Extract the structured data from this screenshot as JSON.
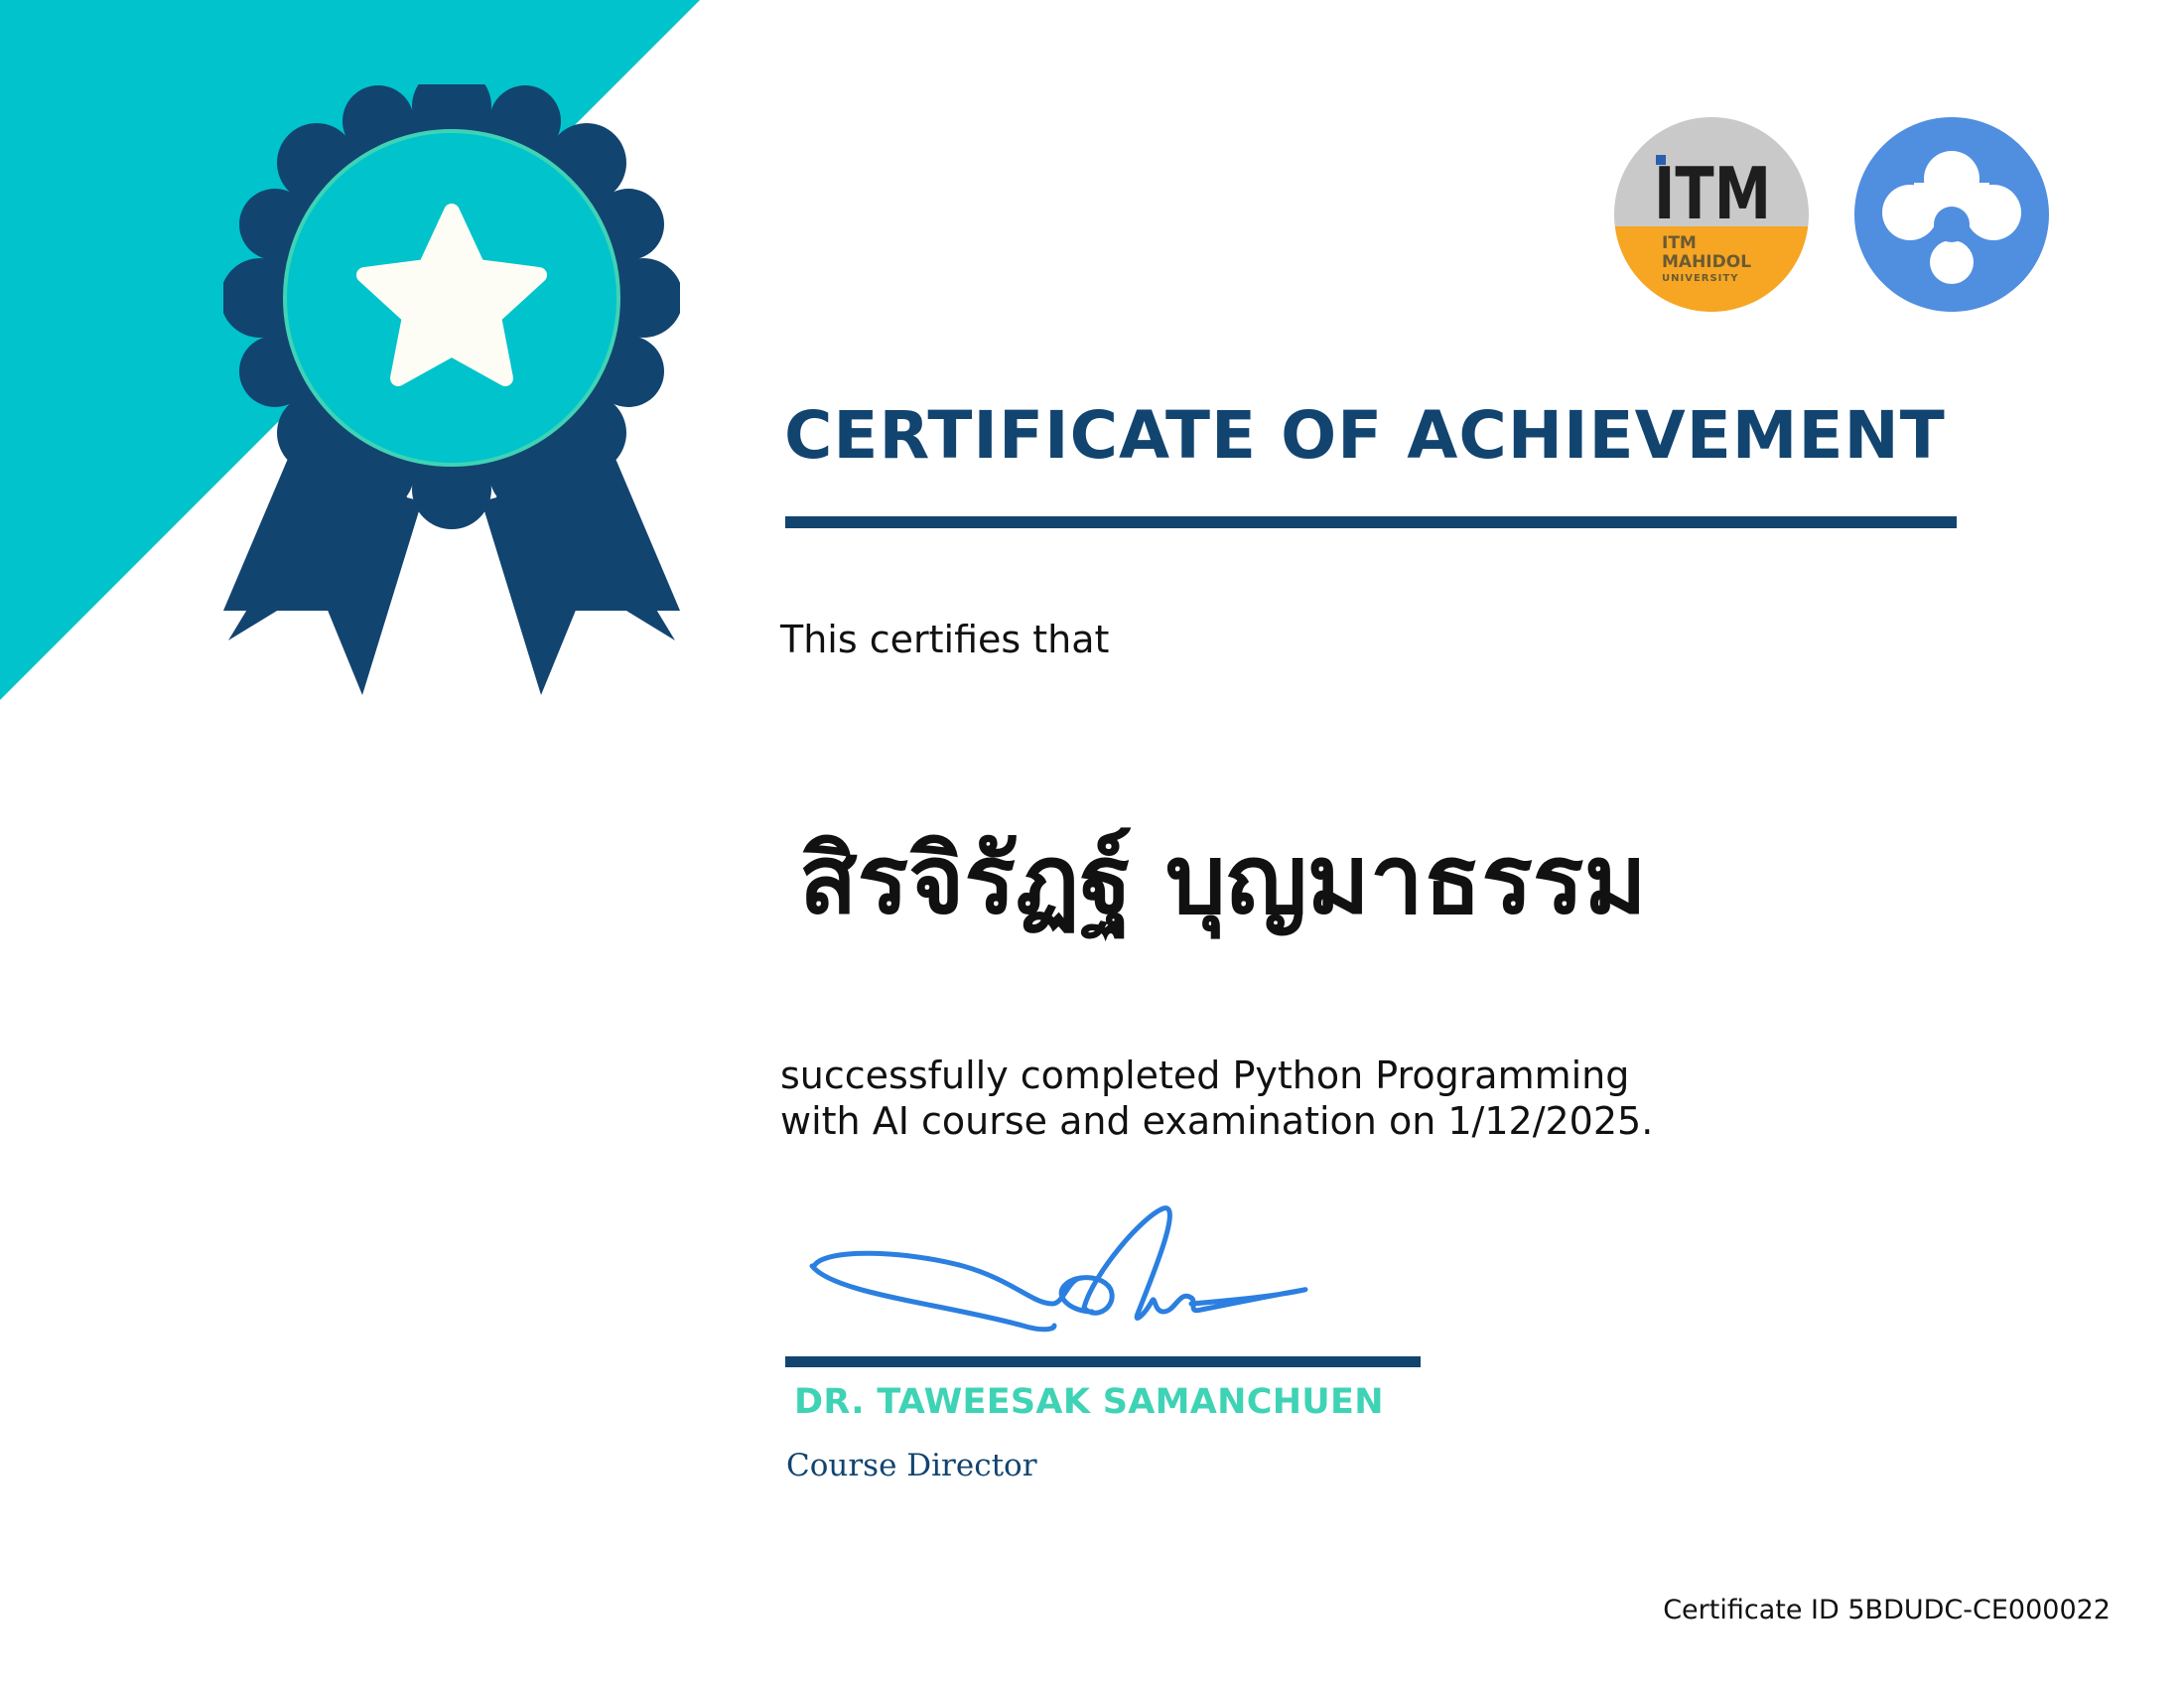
{
  "certificate": {
    "title": "CERTIFICATE OF ACHIEVEMENT",
    "certifies_text": "This certifies that",
    "recipient_name": "สิรจิรัฏฐ์ บุญมาธรรม",
    "completion_line_1": "successfully completed Python Programming",
    "completion_line_2": "with AI course and examination on 1/12/2025.",
    "signer_name": "DR. TAWEESAK SAMANCHUEN",
    "signer_role": "Course Director",
    "certificate_id": "Certificate ID 5BDUDC-CE000022"
  },
  "logos": {
    "itm": {
      "line_1": "ITM",
      "line_2": "MAHIDOL",
      "line_3": "UNIVERSITY"
    }
  },
  "colors": {
    "cyan": "#00c3cb",
    "navy": "#124470",
    "teal_name": "#3fd3b5",
    "signature_blue": "#2b7fe0",
    "logo_blue": "#508ee0",
    "itm_orange": "#f6a623",
    "itm_gray": "#c9c9c9"
  },
  "icons": {
    "badge": "rosette-star-icon",
    "partner_logo": "three-dot-network-icon"
  }
}
